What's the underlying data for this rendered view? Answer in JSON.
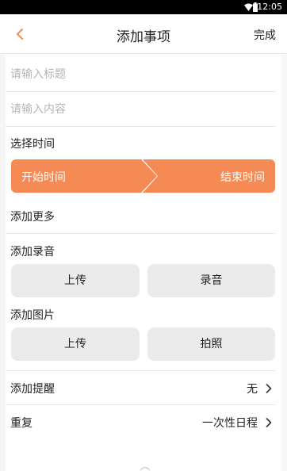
{
  "status_bar": {
    "time": "12:05",
    "wifi_icon": "wifi-icon",
    "battery_icon": "battery-icon"
  },
  "nav": {
    "back_icon": "chevron-left-icon",
    "title": "添加事项",
    "done": "完成",
    "accent_color": "#f58a55"
  },
  "form": {
    "title_placeholder": "请输入标题",
    "content_placeholder": "请输入内容",
    "time_label": "选择时间",
    "start_time": "开始时间",
    "end_time": "结束时间",
    "more_label": "添加更多",
    "audio_label": "添加录音",
    "audio_upload": "上传",
    "audio_record": "录音",
    "image_label": "添加图片",
    "image_upload": "上传",
    "image_photo": "拍照",
    "reminder_label": "添加提醒",
    "reminder_value": "无",
    "repeat_label": "重复",
    "repeat_value": "一次性日程"
  }
}
